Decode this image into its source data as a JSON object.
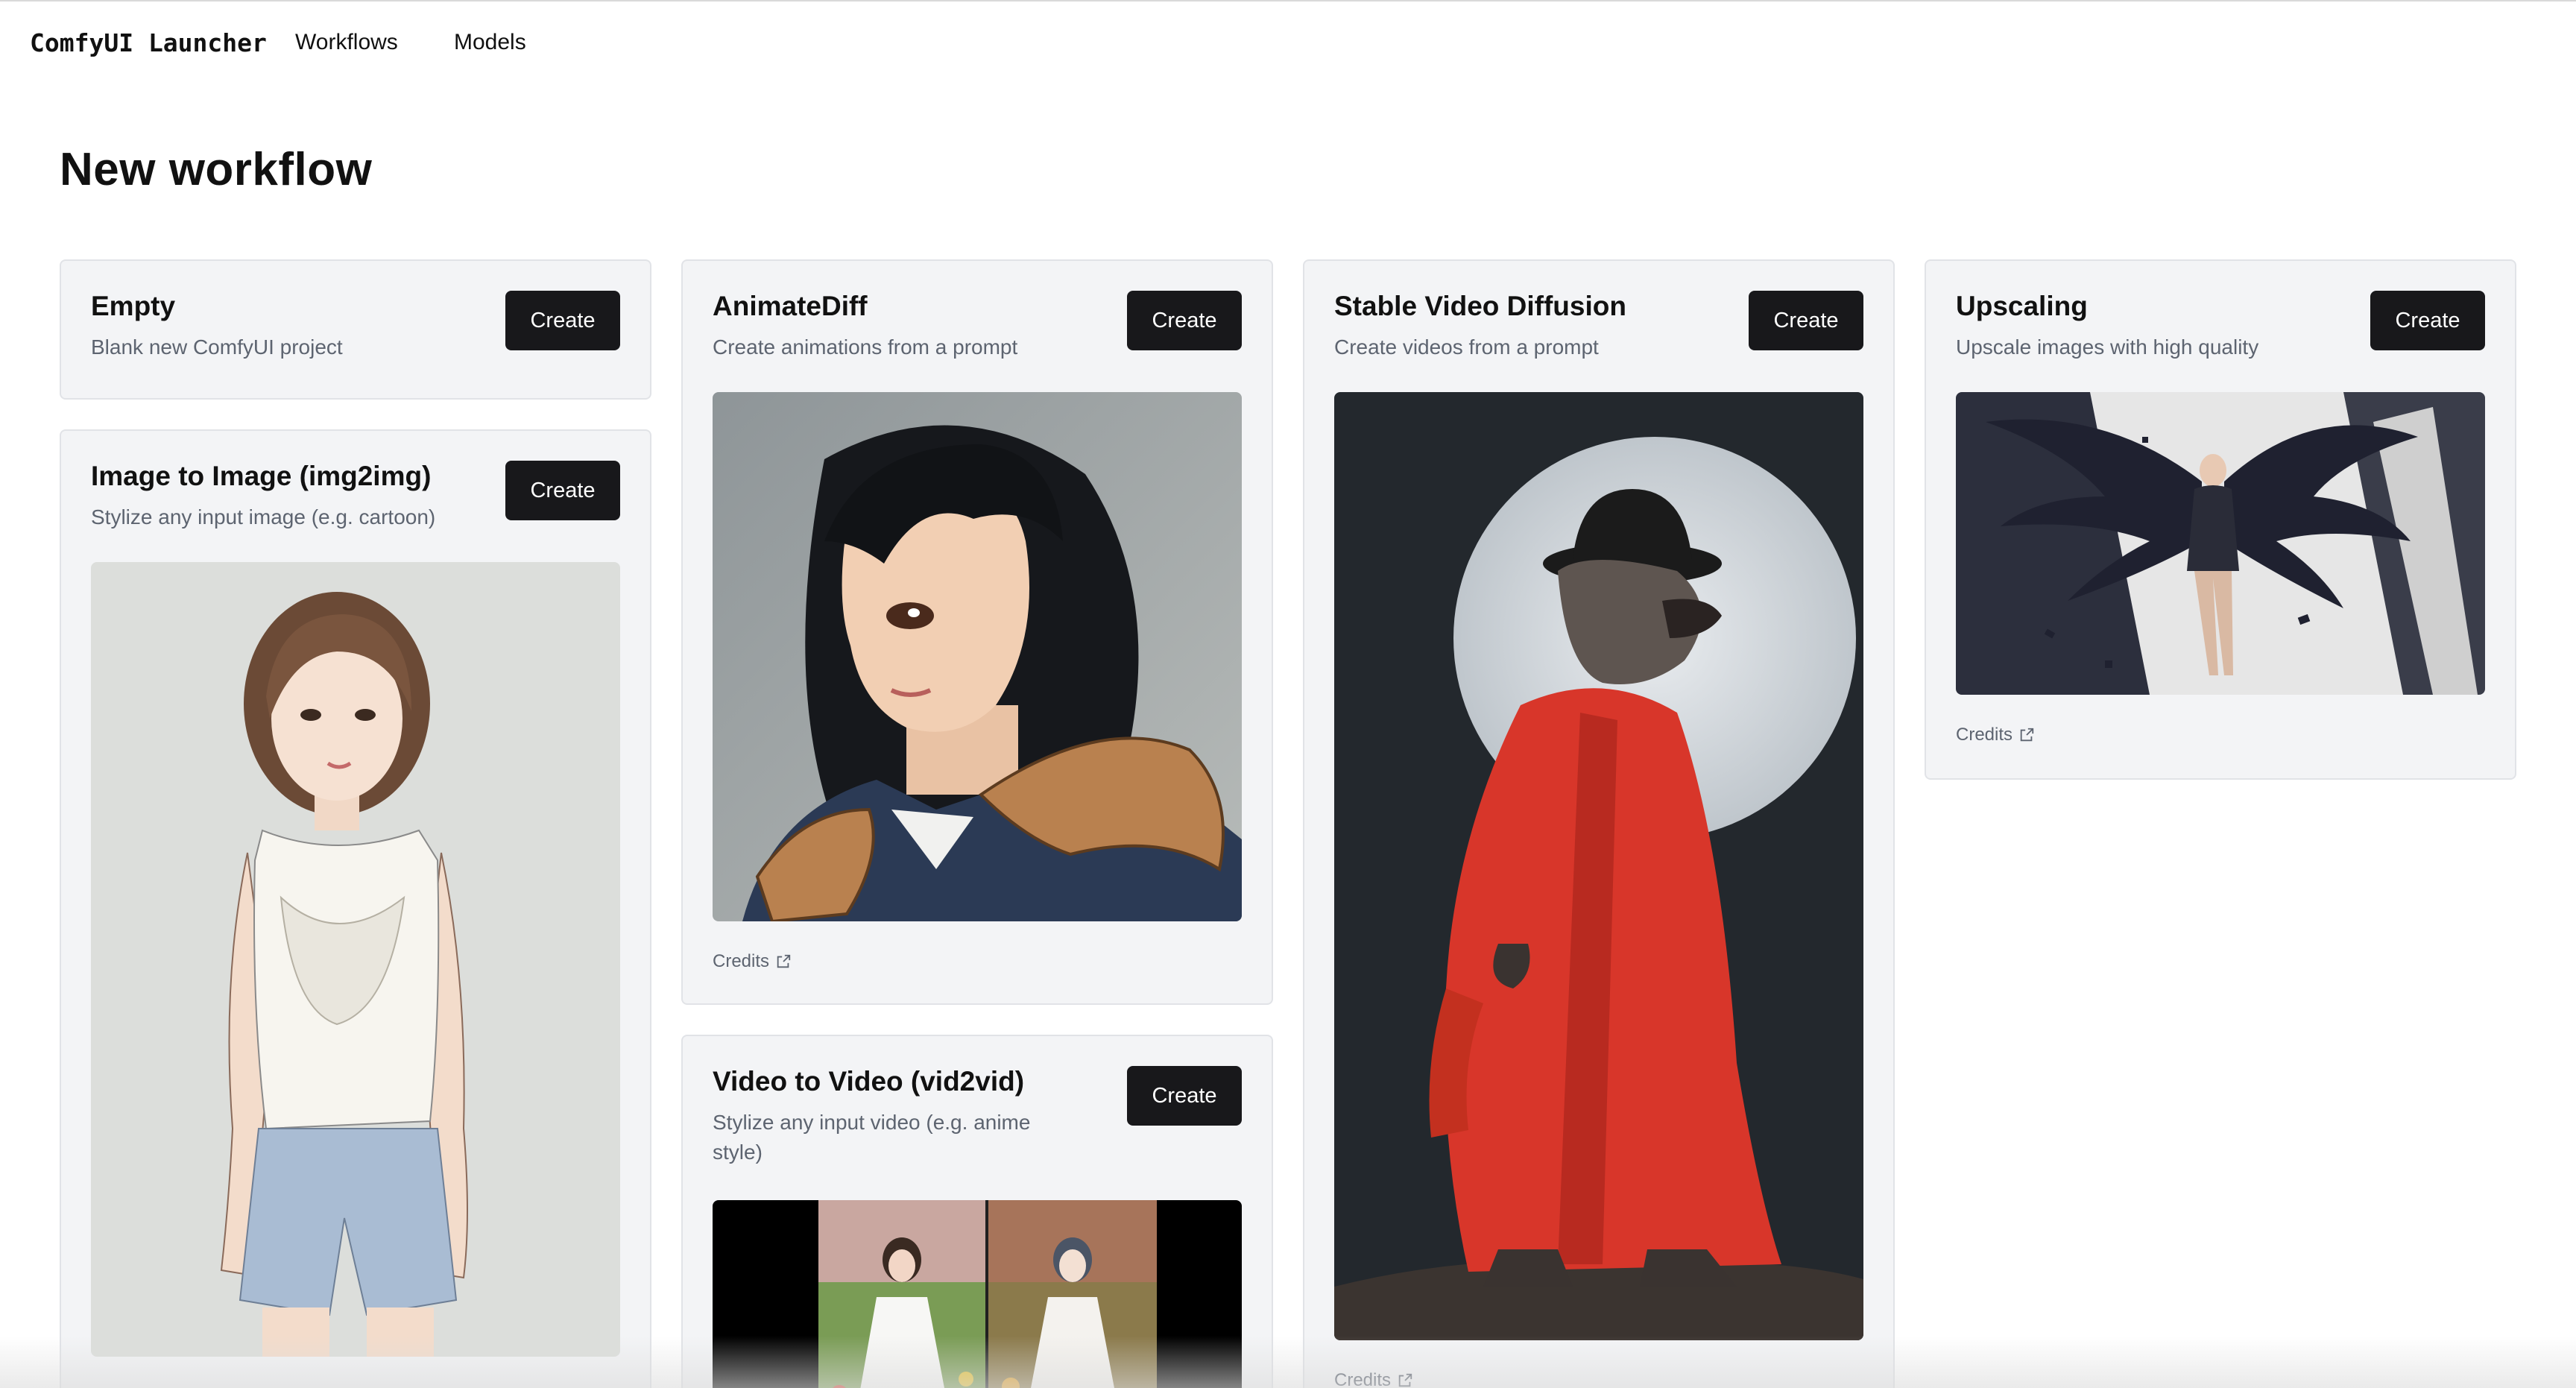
{
  "nav": {
    "brand": "ComfyUI Launcher",
    "workflows": "Workflows",
    "models": "Models"
  },
  "page": {
    "title": "New workflow"
  },
  "create_label": "Create",
  "credits_label": "Credits",
  "cards": {
    "empty": {
      "title": "Empty",
      "description": "Blank new ComfyUI project"
    },
    "img2img": {
      "title": "Image to Image (img2img)",
      "description": "Stylize any input image (e.g. cartoon)"
    },
    "animatediff": {
      "title": "AnimateDiff",
      "description": "Create animations from a prompt"
    },
    "vid2vid": {
      "title": "Video to Video (vid2vid)",
      "description": "Stylize any input video (e.g. anime style)"
    },
    "svd": {
      "title": "Stable Video Diffusion",
      "description": "Create videos from a prompt"
    },
    "upscaling": {
      "title": "Upscaling",
      "description": "Upscale images with high quality"
    }
  },
  "colors": {
    "button_bg": "#18181b",
    "card_bg": "#f3f4f6",
    "card_border": "#e1e3e7",
    "muted_text": "#5d6470"
  }
}
